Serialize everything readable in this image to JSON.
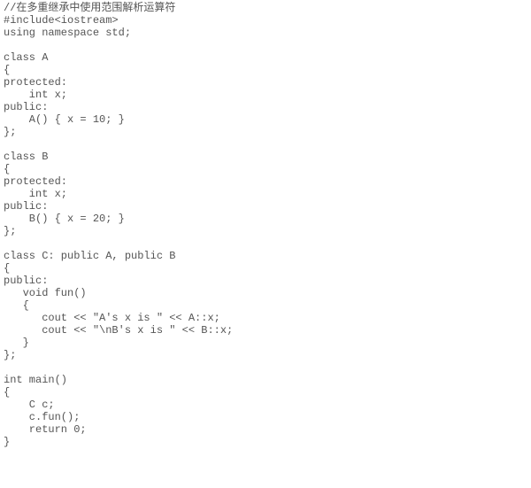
{
  "code": {
    "lines": [
      "//在多重继承中使用范围解析运算符",
      "#include<iostream>",
      "using namespace std;",
      "",
      "class A",
      "{",
      "protected:",
      "    int x;",
      "public:",
      "    A() { x = 10; }",
      "};",
      "",
      "class B",
      "{",
      "protected:",
      "    int x;",
      "public:",
      "    B() { x = 20; }",
      "};",
      "",
      "class C: public A, public B",
      "{",
      "public:",
      "   void fun()",
      "   {",
      "      cout << \"A's x is \" << A::x;",
      "      cout << \"\\nB's x is \" << B::x;",
      "   }",
      "};",
      "",
      "int main()",
      "{",
      "    C c;",
      "    c.fun();",
      "    return 0;",
      "}"
    ]
  }
}
